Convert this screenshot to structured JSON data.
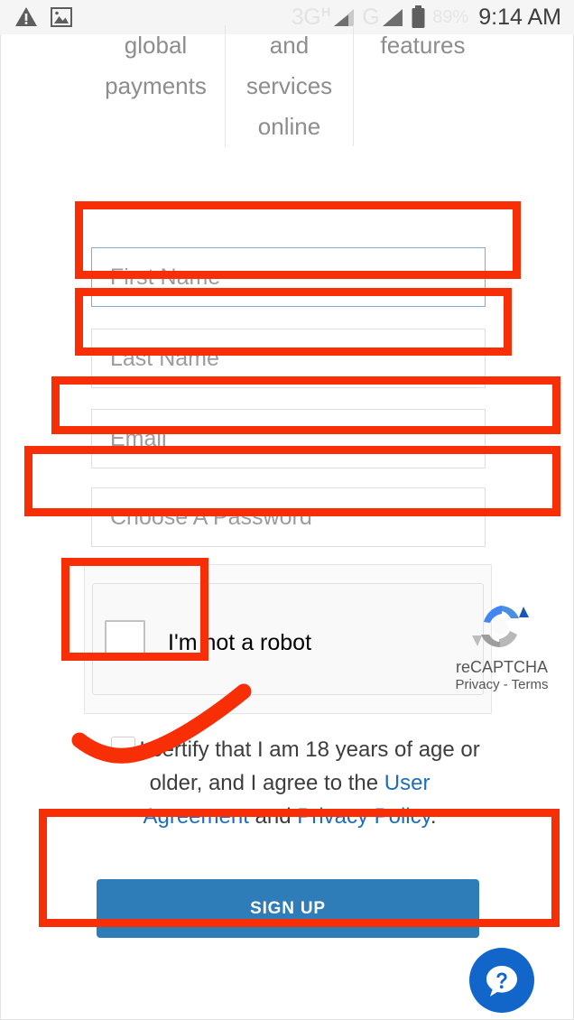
{
  "status_bar": {
    "icons": [
      "warning-triangle-icon",
      "image-icon"
    ],
    "network_primary": "3G",
    "network_primary_sup": "H",
    "network_secondary": "G",
    "battery_percent": "89%",
    "time": "9:14 AM"
  },
  "features": {
    "col1_line1": "global",
    "col1_line2": "payments",
    "col2_line1": "and",
    "col2_line2": "services",
    "col2_line3": "online",
    "col3_line1": "features"
  },
  "form": {
    "first_name_placeholder": "First Name",
    "first_name_value": "",
    "last_name_placeholder": "Last Name",
    "last_name_value": "",
    "email_placeholder": "Email",
    "email_value": "",
    "password_placeholder": "Choose A Password",
    "password_value": "",
    "signup_label": "SIGN UP"
  },
  "recaptcha": {
    "robot_label": "I'm not a robot",
    "brand": "reCAPTCHA",
    "terms": "Privacy - Terms"
  },
  "certify": {
    "text_part1": "I certify that I am 18 years of age or older, and I agree to the ",
    "link_user_agreement": "User Agreement",
    "text_part2": " and ",
    "link_privacy_policy": "Privacy Policy",
    "text_part3": "."
  },
  "help": {
    "icon": "question-speech-bubble-icon"
  },
  "colors": {
    "annotation_red": "#f82e07",
    "button_blue": "#2e7cb8",
    "link_blue": "#1d6fbb",
    "help_blue": "#1266c9",
    "focus_border": "#7aaedc"
  }
}
